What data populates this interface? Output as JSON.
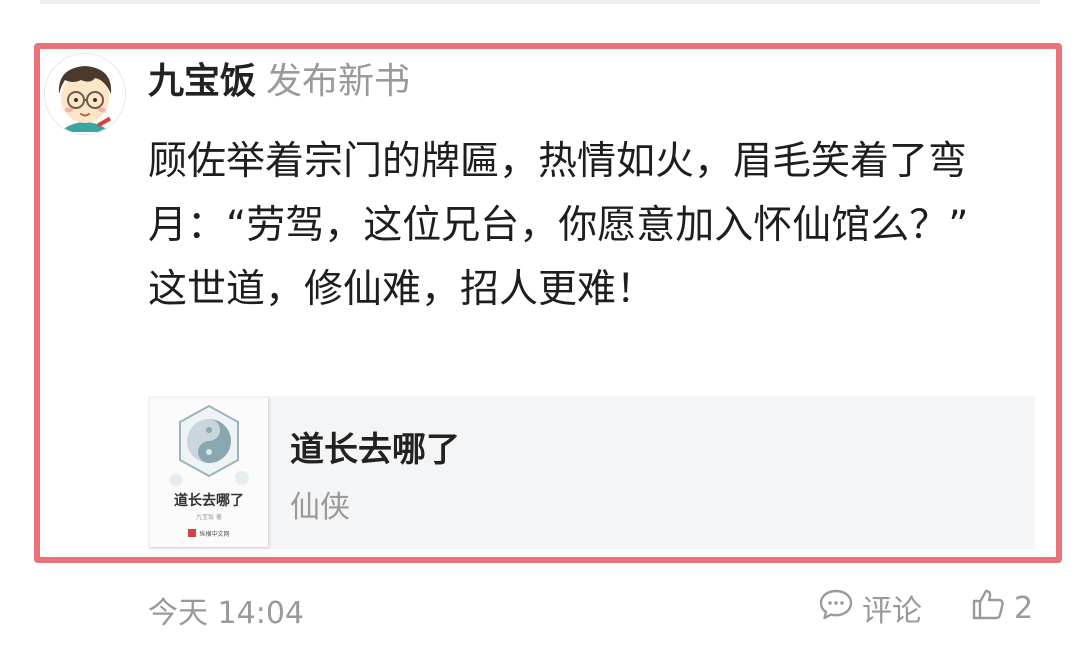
{
  "post": {
    "author_name": "九宝饭",
    "action_text": "发布新书",
    "body": [
      "顾佐举着宗门的牌匾，热情如火，眉毛笑着了弯月：“劳驾，这位兄台，你愿意加入怀仙馆么？”",
      "这世道，修仙难，招人更难！"
    ],
    "book": {
      "title": "道长去哪了",
      "genre": "仙侠",
      "cover": {
        "title": "道长去哪了",
        "author": "九宝饭 著",
        "publisher": "纵横中文网"
      }
    },
    "footer": {
      "time": "今天 14:04",
      "comment_label": "评论",
      "like_count": "2"
    }
  },
  "icons": {
    "comment": "speech-bubble-icon",
    "like": "thumbs-up-icon"
  },
  "colors": {
    "highlight_border": "#e87479",
    "muted_text": "#9a9a9a",
    "card_bg": "#f4f5f7"
  }
}
